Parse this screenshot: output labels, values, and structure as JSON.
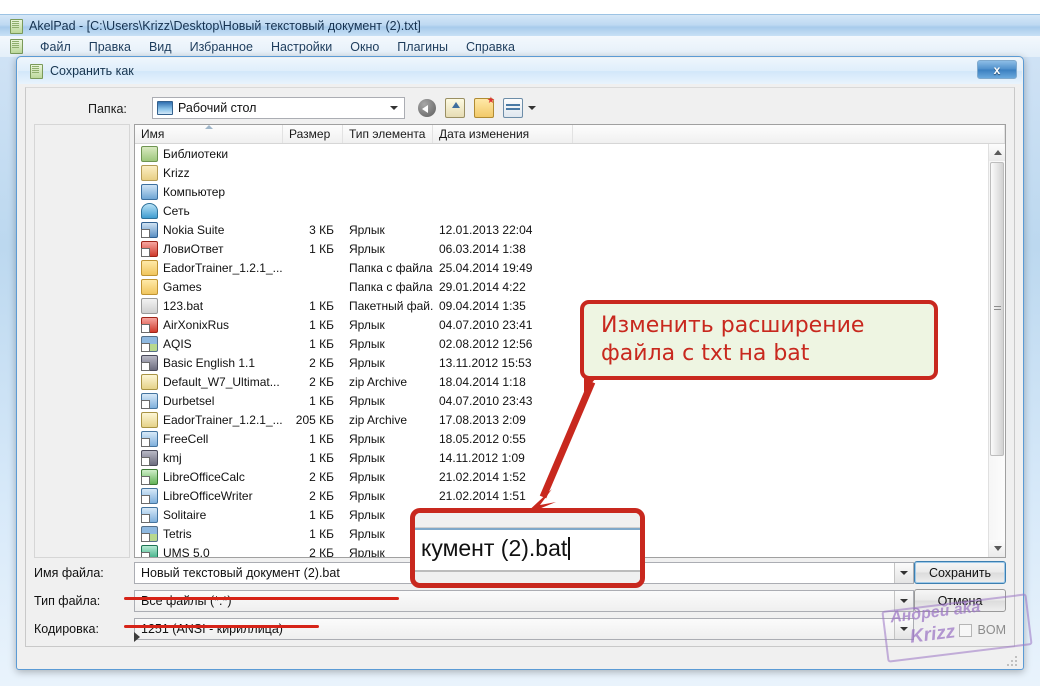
{
  "akelpad": {
    "title": "AkelPad - [C:\\Users\\Krizz\\Desktop\\Новый текстовый документ (2).txt]",
    "icon": "notepad-icon",
    "menu": [
      "Файл",
      "Правка",
      "Вид",
      "Избранное",
      "Настройки",
      "Окно",
      "Плагины",
      "Справка"
    ]
  },
  "dialog": {
    "title": "Сохранить как",
    "icon": "notepad-icon",
    "close_label": "x",
    "lookin": {
      "label": "Папка:",
      "value": "Рабочий стол",
      "icon": "monitor-icon",
      "arrow_icon": "chevron-down-icon"
    },
    "toolbar": [
      {
        "name": "back-icon",
        "title": "Назад"
      },
      {
        "name": "up-folder-icon",
        "title": "Вверх"
      },
      {
        "name": "new-folder-icon",
        "title": "Создать папку"
      },
      {
        "name": "view-mode-icon",
        "title": "Представления"
      }
    ],
    "columns": [
      "Имя",
      "Размер",
      "Тип элемента",
      "Дата изменения"
    ],
    "files": [
      {
        "name": "Библиотеки",
        "size": "",
        "type": "",
        "date": "",
        "icon": "library-icon"
      },
      {
        "name": "Krizz",
        "size": "",
        "type": "",
        "date": "",
        "icon": "user-folder-icon"
      },
      {
        "name": "Компьютер",
        "size": "",
        "type": "",
        "date": "",
        "icon": "computer-icon"
      },
      {
        "name": "Сеть",
        "size": "",
        "type": "",
        "date": "",
        "icon": "network-icon"
      },
      {
        "name": "Nokia Suite",
        "size": "3 КБ",
        "type": "Ярлык",
        "date": "12.01.2013 22:04",
        "icon": "nokia-shortcut-icon"
      },
      {
        "name": "ЛовиОтвет",
        "size": "1 КБ",
        "type": "Ярлык",
        "date": "06.03.2014 1:38",
        "icon": "red-app-shortcut-icon"
      },
      {
        "name": "EadorTrainer_1.2.1_...",
        "size": "",
        "type": "Папка с файла...",
        "date": "25.04.2014 19:49",
        "icon": "folder-icon"
      },
      {
        "name": "Games",
        "size": "",
        "type": "Папка с файла...",
        "date": "29.01.2014 4:22",
        "icon": "folder-icon"
      },
      {
        "name": "123.bat",
        "size": "1 КБ",
        "type": "Пакетный фай...",
        "date": "09.04.2014 1:35",
        "icon": "bat-file-icon"
      },
      {
        "name": "AirXonixRus",
        "size": "1 КБ",
        "type": "Ярлык",
        "date": "04.07.2010 23:41",
        "icon": "red-app-shortcut-icon"
      },
      {
        "name": "AQIS",
        "size": "1 КБ",
        "type": "Ярлык",
        "date": "02.08.2012 12:56",
        "icon": "multicolor-shortcut-icon"
      },
      {
        "name": "Basic English 1.1",
        "size": "2 КБ",
        "type": "Ярлык",
        "date": "13.11.2012 15:53",
        "icon": "dark-app-shortcut-icon"
      },
      {
        "name": "Default_W7_Ultimat...",
        "size": "2 КБ",
        "type": "zip Archive",
        "date": "18.04.2014 1:18",
        "icon": "zip-archive-icon"
      },
      {
        "name": "Durbetsel",
        "size": "1 КБ",
        "type": "Ярлык",
        "date": "04.07.2010 23:43",
        "icon": "blue-app-shortcut-icon"
      },
      {
        "name": "EadorTrainer_1.2.1_...",
        "size": "205 КБ",
        "type": "zip Archive",
        "date": "17.08.2013 2:09",
        "icon": "zip-archive-icon"
      },
      {
        "name": "FreeCell",
        "size": "1 КБ",
        "type": "Ярлык",
        "date": "18.05.2012 0:55",
        "icon": "blue-app-shortcut-icon"
      },
      {
        "name": "kmj",
        "size": "1 КБ",
        "type": "Ярлык",
        "date": "14.11.2012 1:09",
        "icon": "dark-app-shortcut-icon"
      },
      {
        "name": "LibreOfficeCalc",
        "size": "2 КБ",
        "type": "Ярлык",
        "date": "21.02.2014 1:52",
        "icon": "green-app-shortcut-icon"
      },
      {
        "name": "LibreOfficeWriter",
        "size": "2 КБ",
        "type": "Ярлык",
        "date": "21.02.2014 1:51",
        "icon": "blue-app-shortcut-icon"
      },
      {
        "name": "Solitaire",
        "size": "1 КБ",
        "type": "Ярлык",
        "date": "",
        "icon": "blue-app-shortcut-icon"
      },
      {
        "name": "Tetris",
        "size": "1 КБ",
        "type": "Ярлык",
        "date": "",
        "icon": "multicolor-shortcut-icon"
      },
      {
        "name": "UMS 5.0",
        "size": "2 КБ",
        "type": "Ярлык",
        "date": "",
        "icon": "teal-app-shortcut-icon"
      }
    ],
    "form": {
      "filename_label": "Имя файла:",
      "filename_value": "Новый текстовый документ (2).bat",
      "filetype_label": "Тип файла:",
      "filetype_value": "Все файлы (*.*)",
      "encoding_label": "Кодировка:",
      "encoding_value": "1251  (ANSI - кириллица)",
      "save_button": "Сохранить",
      "cancel_button": "Отмена",
      "bom_label": "BOM"
    }
  },
  "annotation": {
    "callout_line1": "Изменить расширение",
    "callout_line2": "файла с txt на bat",
    "callout_bg": "#eef5e2",
    "callout_border": "#c8281e",
    "callout_text_color": "#c8281e",
    "zoom_text": "кумент (2).bat",
    "arrow_color": "#c8281e",
    "underline_color": "#d62418"
  },
  "watermark": {
    "line1": "Андрей aka",
    "line2": "Krizz",
    "color": "#9b74c4"
  }
}
